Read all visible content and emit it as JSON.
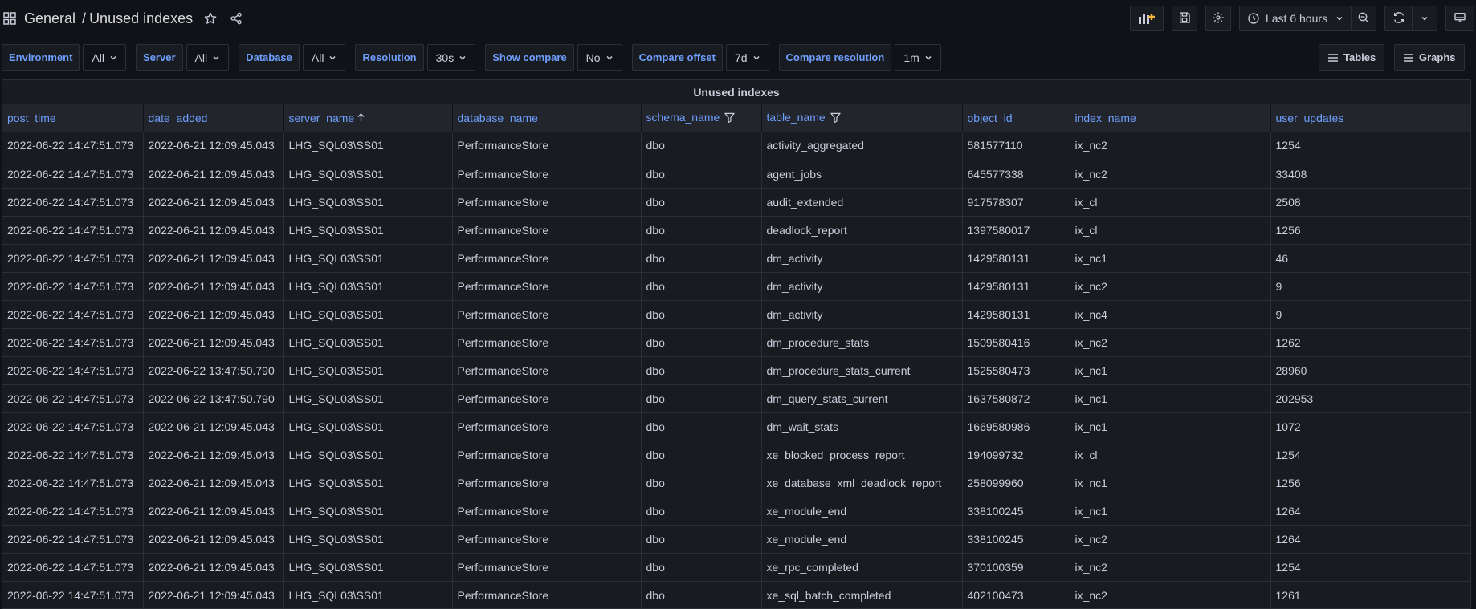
{
  "header": {
    "folder": "General",
    "separator": "/",
    "title": "Unused indexes",
    "time_range": "Last 6 hours"
  },
  "variables": [
    {
      "label": "Environment",
      "value": "All"
    },
    {
      "label": "Server",
      "value": "All"
    },
    {
      "label": "Database",
      "value": "All"
    },
    {
      "label": "Resolution",
      "value": "30s"
    },
    {
      "label": "Show compare",
      "value": "No"
    },
    {
      "label": "Compare offset",
      "value": "7d"
    },
    {
      "label": "Compare resolution",
      "value": "1m"
    }
  ],
  "view_buttons": {
    "tables": "Tables",
    "graphs": "Graphs"
  },
  "panel": {
    "title": "Unused indexes",
    "columns": [
      "post_time",
      "date_added",
      "server_name",
      "database_name",
      "schema_name",
      "table_name",
      "object_id",
      "index_name",
      "user_updates"
    ],
    "rows": [
      [
        "2022-06-22 14:47:51.073",
        "2022-06-21 12:09:45.043",
        "LHG_SQL03\\SS01",
        "PerformanceStore",
        "dbo",
        "activity_aggregated",
        "581577110",
        "ix_nc2",
        "1254"
      ],
      [
        "2022-06-22 14:47:51.073",
        "2022-06-21 12:09:45.043",
        "LHG_SQL03\\SS01",
        "PerformanceStore",
        "dbo",
        "agent_jobs",
        "645577338",
        "ix_nc2",
        "33408"
      ],
      [
        "2022-06-22 14:47:51.073",
        "2022-06-21 12:09:45.043",
        "LHG_SQL03\\SS01",
        "PerformanceStore",
        "dbo",
        "audit_extended",
        "917578307",
        "ix_cl",
        "2508"
      ],
      [
        "2022-06-22 14:47:51.073",
        "2022-06-21 12:09:45.043",
        "LHG_SQL03\\SS01",
        "PerformanceStore",
        "dbo",
        "deadlock_report",
        "1397580017",
        "ix_cl",
        "1256"
      ],
      [
        "2022-06-22 14:47:51.073",
        "2022-06-21 12:09:45.043",
        "LHG_SQL03\\SS01",
        "PerformanceStore",
        "dbo",
        "dm_activity",
        "1429580131",
        "ix_nc1",
        "46"
      ],
      [
        "2022-06-22 14:47:51.073",
        "2022-06-21 12:09:45.043",
        "LHG_SQL03\\SS01",
        "PerformanceStore",
        "dbo",
        "dm_activity",
        "1429580131",
        "ix_nc2",
        "9"
      ],
      [
        "2022-06-22 14:47:51.073",
        "2022-06-21 12:09:45.043",
        "LHG_SQL03\\SS01",
        "PerformanceStore",
        "dbo",
        "dm_activity",
        "1429580131",
        "ix_nc4",
        "9"
      ],
      [
        "2022-06-22 14:47:51.073",
        "2022-06-21 12:09:45.043",
        "LHG_SQL03\\SS01",
        "PerformanceStore",
        "dbo",
        "dm_procedure_stats",
        "1509580416",
        "ix_nc2",
        "1262"
      ],
      [
        "2022-06-22 14:47:51.073",
        "2022-06-22 13:47:50.790",
        "LHG_SQL03\\SS01",
        "PerformanceStore",
        "dbo",
        "dm_procedure_stats_current",
        "1525580473",
        "ix_nc1",
        "28960"
      ],
      [
        "2022-06-22 14:47:51.073",
        "2022-06-22 13:47:50.790",
        "LHG_SQL03\\SS01",
        "PerformanceStore",
        "dbo",
        "dm_query_stats_current",
        "1637580872",
        "ix_nc1",
        "202953"
      ],
      [
        "2022-06-22 14:47:51.073",
        "2022-06-21 12:09:45.043",
        "LHG_SQL03\\SS01",
        "PerformanceStore",
        "dbo",
        "dm_wait_stats",
        "1669580986",
        "ix_nc1",
        "1072"
      ],
      [
        "2022-06-22 14:47:51.073",
        "2022-06-21 12:09:45.043",
        "LHG_SQL03\\SS01",
        "PerformanceStore",
        "dbo",
        "xe_blocked_process_report",
        "194099732",
        "ix_cl",
        "1254"
      ],
      [
        "2022-06-22 14:47:51.073",
        "2022-06-21 12:09:45.043",
        "LHG_SQL03\\SS01",
        "PerformanceStore",
        "dbo",
        "xe_database_xml_deadlock_report",
        "258099960",
        "ix_nc1",
        "1256"
      ],
      [
        "2022-06-22 14:47:51.073",
        "2022-06-21 12:09:45.043",
        "LHG_SQL03\\SS01",
        "PerformanceStore",
        "dbo",
        "xe_module_end",
        "338100245",
        "ix_nc1",
        "1264"
      ],
      [
        "2022-06-22 14:47:51.073",
        "2022-06-21 12:09:45.043",
        "LHG_SQL03\\SS01",
        "PerformanceStore",
        "dbo",
        "xe_module_end",
        "338100245",
        "ix_nc2",
        "1264"
      ],
      [
        "2022-06-22 14:47:51.073",
        "2022-06-21 12:09:45.043",
        "LHG_SQL03\\SS01",
        "PerformanceStore",
        "dbo",
        "xe_rpc_completed",
        "370100359",
        "ix_nc2",
        "1254"
      ],
      [
        "2022-06-22 14:47:51.073",
        "2022-06-21 12:09:45.043",
        "LHG_SQL03\\SS01",
        "PerformanceStore",
        "dbo",
        "xe_sql_batch_completed",
        "402100473",
        "ix_nc2",
        "1261"
      ]
    ]
  },
  "icons": {
    "apps": "grid-icon",
    "favorite": "star-icon",
    "share": "share-icon",
    "add_panel": "add-panel-icon",
    "save": "save-icon",
    "settings": "gear-icon",
    "clock": "clock-icon",
    "zoom_out": "zoom-out-icon",
    "refresh": "refresh-icon",
    "tv_mode": "monitor-icon",
    "sort": "sort-asc-icon",
    "filter": "filter-icon"
  },
  "colors": {
    "accent": "#6e9fff",
    "background": "#111217",
    "panel": "#181b1f",
    "add_panel": "#f5b73b"
  }
}
